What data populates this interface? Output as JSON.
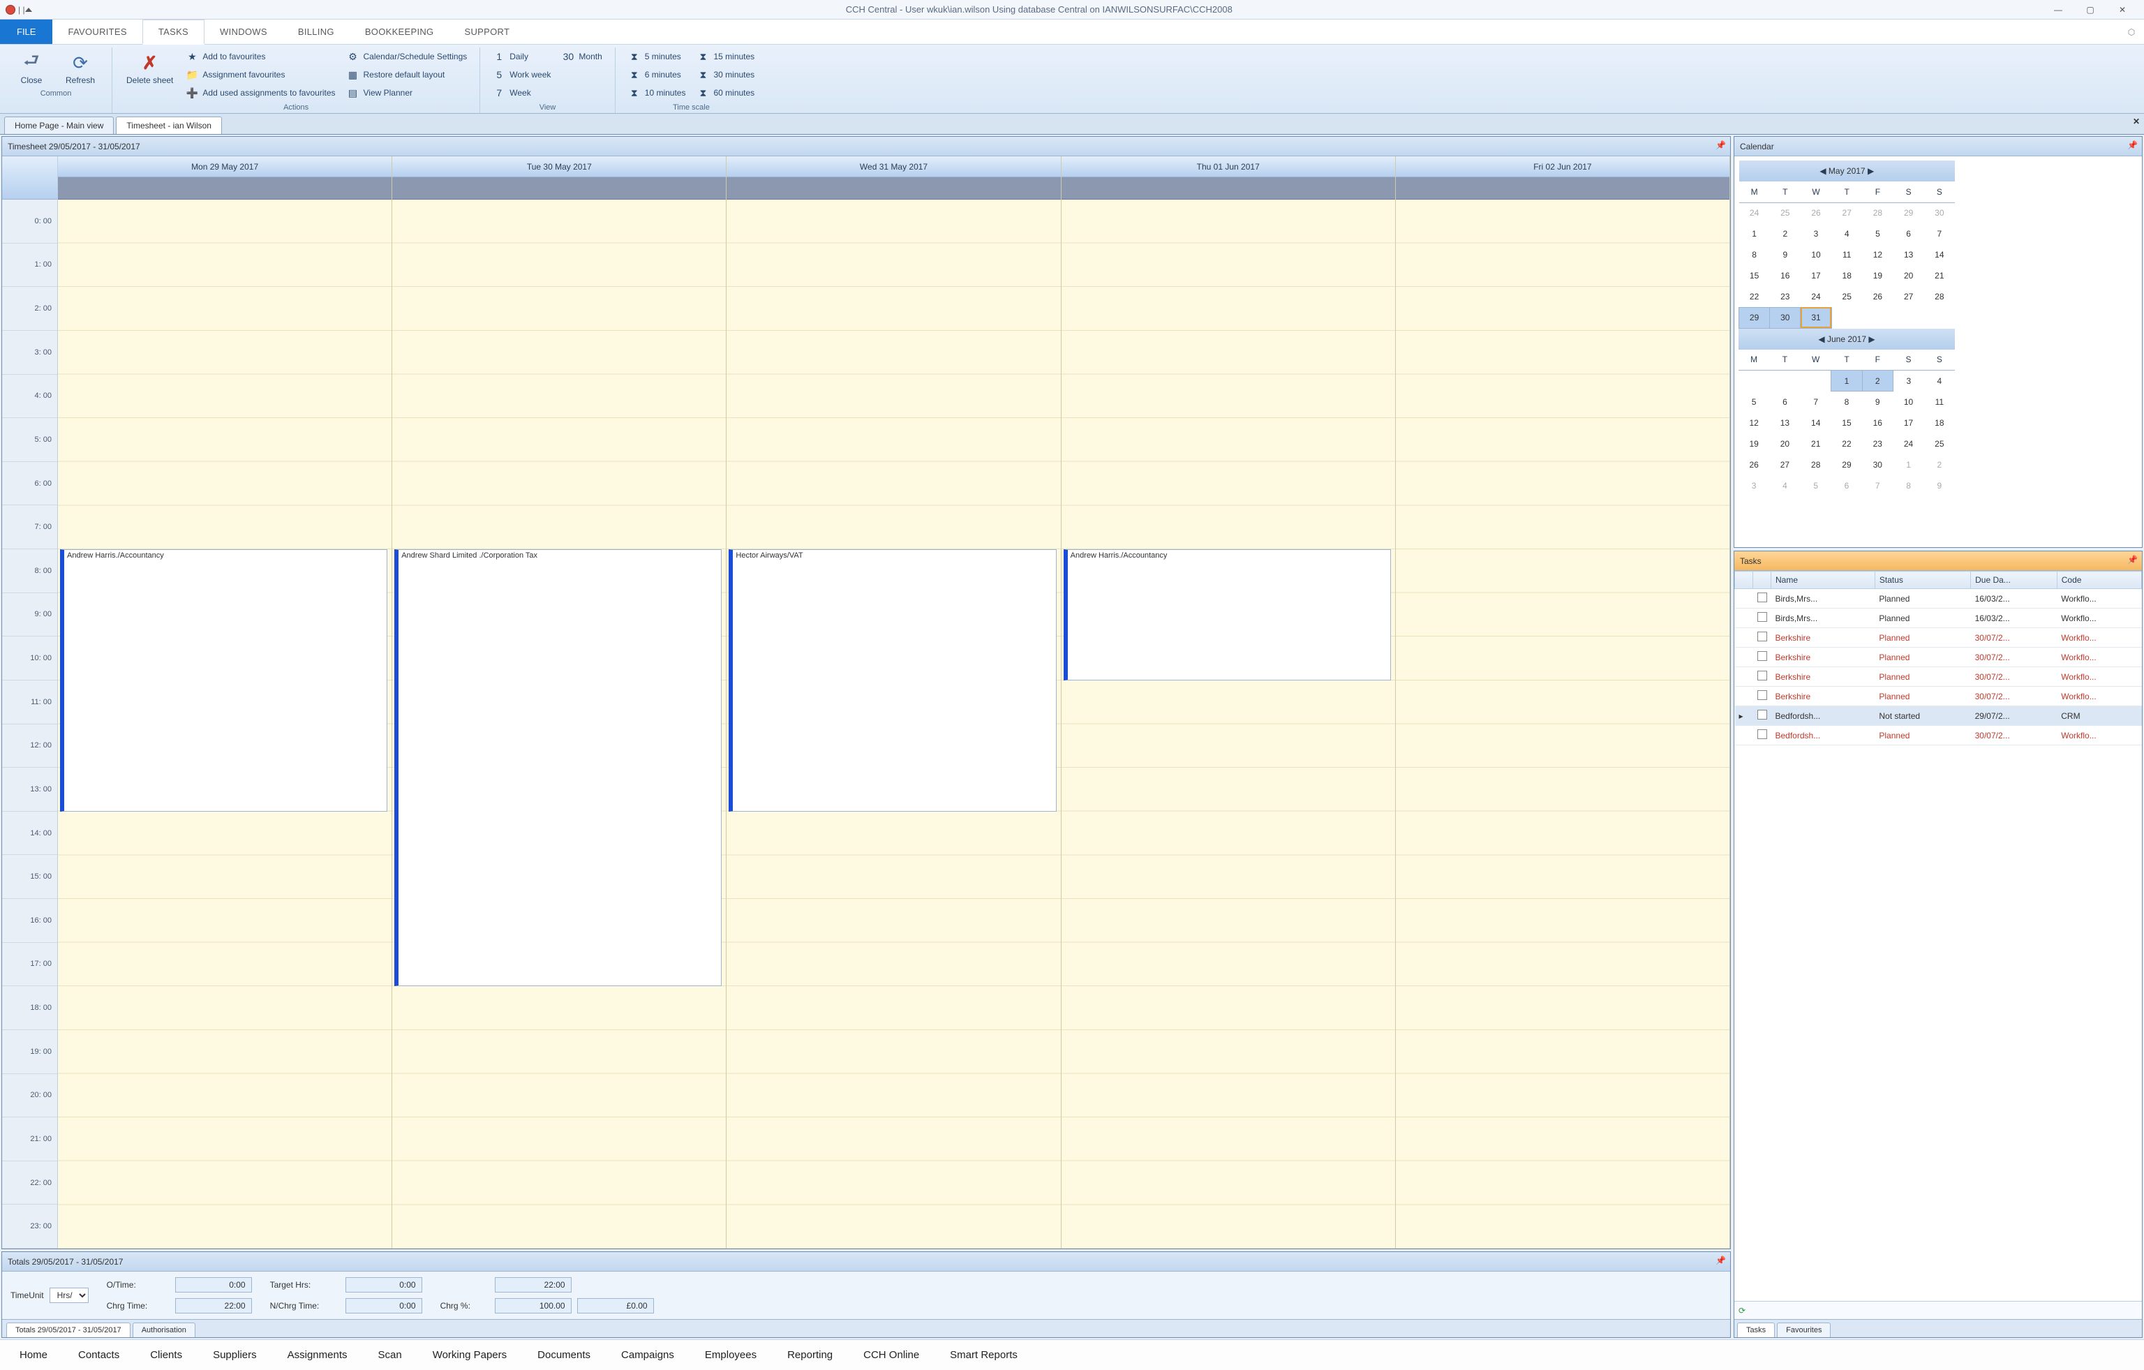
{
  "window": {
    "title": "CCH Central - User wkuk\\ian.wilson Using database Central on IANWILSONSURFAC\\CCH2008"
  },
  "menu": {
    "file": "FILE",
    "tabs": [
      "FAVOURITES",
      "TASKS",
      "WINDOWS",
      "BILLING",
      "BOOKKEEPING",
      "SUPPORT"
    ],
    "active": 1
  },
  "ribbon": {
    "common": {
      "close": "Close",
      "refresh": "Refresh",
      "label": "Common"
    },
    "actions": {
      "delete": "Delete sheet",
      "fav": "Add to favourites",
      "assign": "Assignment favourites",
      "used": "Add used assignments to favourites",
      "cal": "Calendar/Schedule Settings",
      "restore": "Restore default layout",
      "planner": "View Planner",
      "label": "Actions"
    },
    "view": {
      "daily": "Daily",
      "month": "Month",
      "wweek": "Work week",
      "week": "Week",
      "label": "View"
    },
    "timescale": {
      "m5": "5 minutes",
      "m15": "15 minutes",
      "m6": "6 minutes",
      "m30": "30 minutes",
      "m10": "10 minutes",
      "m60": "60 minutes",
      "label": "Time scale"
    }
  },
  "doctabs": {
    "home": "Home Page - Main view",
    "ts": "Timesheet - ian Wilson"
  },
  "timesheet": {
    "title": "Timesheet 29/05/2017 - 31/05/2017",
    "days": [
      "Mon 29 May 2017",
      "Tue 30 May 2017",
      "Wed 31 May 2017",
      "Thu 01 Jun 2017",
      "Fri 02 Jun 2017"
    ],
    "hours": [
      "0: 00",
      "1: 00",
      "2: 00",
      "3: 00",
      "4: 00",
      "5: 00",
      "6: 00",
      "7: 00",
      "8: 00",
      "9: 00",
      "10: 00",
      "11: 00",
      "12: 00",
      "13: 00",
      "14: 00",
      "15: 00",
      "16: 00",
      "17: 00",
      "18: 00",
      "19: 00",
      "20: 00",
      "21: 00",
      "22: 00",
      "23: 00"
    ],
    "appts": [
      {
        "day": 0,
        "start": 8,
        "end": 14,
        "text": "Andrew Harris./Accountancy"
      },
      {
        "day": 1,
        "start": 8,
        "end": 18,
        "text": "Andrew Shard Limited ./Corporation Tax"
      },
      {
        "day": 2,
        "start": 8,
        "end": 14,
        "text": "Hector Airways/VAT"
      },
      {
        "day": 3,
        "start": 8,
        "end": 11,
        "text": "Andrew Harris./Accountancy"
      }
    ]
  },
  "totals": {
    "title": "Totals 29/05/2017 - 31/05/2017",
    "timeunit_lbl": "TimeUnit",
    "timeunit": "Hrs/",
    "otime_lbl": "O/Time:",
    "otime": "0:00",
    "chrg_lbl": "Chrg Time:",
    "chrg": "22:00",
    "target_lbl": "Target Hrs:",
    "target": "0:00",
    "nchrg_lbl": "N/Chrg Time:",
    "nchrg": "0:00",
    "chrgp_lbl": "Chrg %:",
    "chrgp": "100.00",
    "tot_h": "22:00",
    "tot_m": "£0.00",
    "tab1": "Totals 29/05/2017 - 31/05/2017",
    "tab2": "Authorisation"
  },
  "calendar": {
    "title": "Calendar",
    "may": "May 2017",
    "june": "June 2017",
    "dow": [
      "M",
      "T",
      "W",
      "T",
      "F",
      "S",
      "S"
    ]
  },
  "tasks": {
    "title": "Tasks",
    "cols": [
      "Name",
      "Status",
      "Due Da...",
      "Code"
    ],
    "rows": [
      {
        "n": "Birds,Mrs...",
        "s": "Planned",
        "d": "16/03/2...",
        "c": "Workflo...",
        "red": false
      },
      {
        "n": "Birds,Mrs...",
        "s": "Planned",
        "d": "16/03/2...",
        "c": "Workflo...",
        "red": false
      },
      {
        "n": "Berkshire",
        "s": "Planned",
        "d": "30/07/2...",
        "c": "Workflo...",
        "red": true
      },
      {
        "n": "Berkshire",
        "s": "Planned",
        "d": "30/07/2...",
        "c": "Workflo...",
        "red": true
      },
      {
        "n": "Berkshire",
        "s": "Planned",
        "d": "30/07/2...",
        "c": "Workflo...",
        "red": true
      },
      {
        "n": "Berkshire",
        "s": "Planned",
        "d": "30/07/2...",
        "c": "Workflo...",
        "red": true
      },
      {
        "n": "Bedfordsh...",
        "s": "Not started",
        "d": "29/07/2...",
        "c": "CRM",
        "red": false,
        "sel": true
      },
      {
        "n": "Bedfordsh...",
        "s": "Planned",
        "d": "30/07/2...",
        "c": "Workflo...",
        "red": true
      }
    ],
    "tab1": "Tasks",
    "tab2": "Favourites"
  },
  "bottomnav": [
    "Home",
    "Contacts",
    "Clients",
    "Suppliers",
    "Assignments",
    "Scan",
    "Working Papers",
    "Documents",
    "Campaigns",
    "Employees",
    "Reporting",
    "CCH Online",
    "Smart Reports"
  ]
}
